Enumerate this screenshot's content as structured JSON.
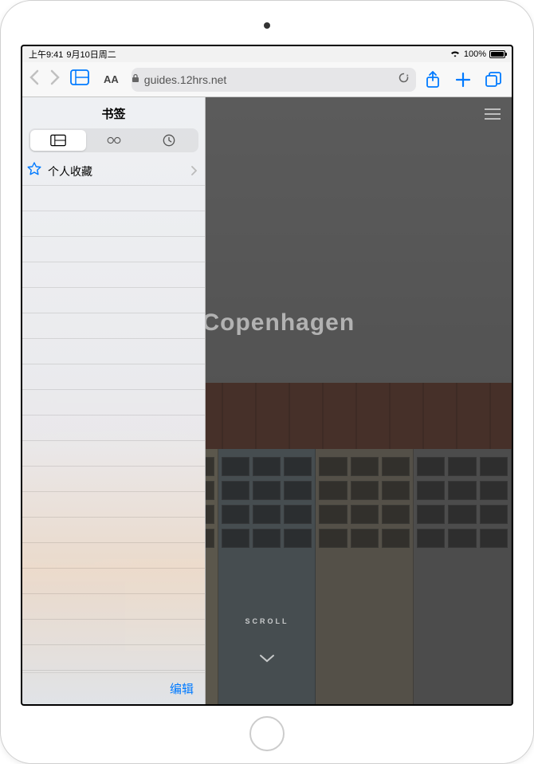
{
  "status": {
    "time": "上午9:41",
    "date": "9月10日周二",
    "battery_pct": "100%"
  },
  "toolbar": {
    "text_size_label": "AA",
    "url": "guides.12hrs.net"
  },
  "sidebar": {
    "title": "书签",
    "favorites_label": "个人收藏",
    "edit_label": "编辑"
  },
  "page": {
    "headline_fragment": "n Copenhagen",
    "scroll_label": "SCROLL"
  }
}
